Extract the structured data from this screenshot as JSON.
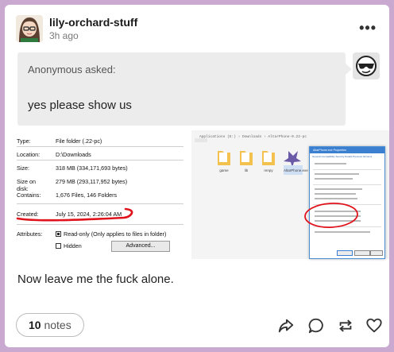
{
  "post": {
    "blog_name": "lily-orchard-stuff",
    "time_ago": "3h ago",
    "more_icon": "more-horizontal-icon"
  },
  "ask": {
    "asker": "Anonymous",
    "asked_label": "asked:",
    "question": "yes please show us"
  },
  "screenshot_left": {
    "rows": [
      {
        "label": "Type:",
        "value": "File folder (.22-pc)"
      },
      {
        "label": "Location:",
        "value": "D:\\Downloads"
      },
      {
        "label": "Size:",
        "value": "318 MB (334,171,693 bytes)"
      },
      {
        "label": "Size on disk:",
        "value": "279 MB (293,117,952 bytes)"
      },
      {
        "label": "Contains:",
        "value": "1,676 Files, 146 Folders"
      },
      {
        "label": "Created:",
        "value": "July 15, 2024, 2:26:04 AM"
      }
    ],
    "attributes_label": "Attributes:",
    "readonly_label": "Read-only (Only applies to files in folder)",
    "hidden_label": "Hidden",
    "advanced_label": "Advanced...",
    "annotation_color": "#e0121b"
  },
  "screenshot_right": {
    "breadcrumb": "Applications (E:) › Downloads › AltarPhone-0.22-pc",
    "folders": [
      "game",
      "lib",
      "renpy"
    ],
    "exe_label": "AltarPhone.exe",
    "dialog_title": "AltarPhone.exe Properties",
    "dialog_tabs": "General  Compatibility  Security  Details  Previous Versions",
    "annotation_color": "#e0121b"
  },
  "caption": "Now leave me the fuck alone.",
  "footer": {
    "notes_count": "10",
    "notes_label": "notes"
  },
  "colors": {
    "page_bg": "#c9a9d0",
    "card_bg": "#ffffff",
    "ask_bg": "#ececec"
  }
}
